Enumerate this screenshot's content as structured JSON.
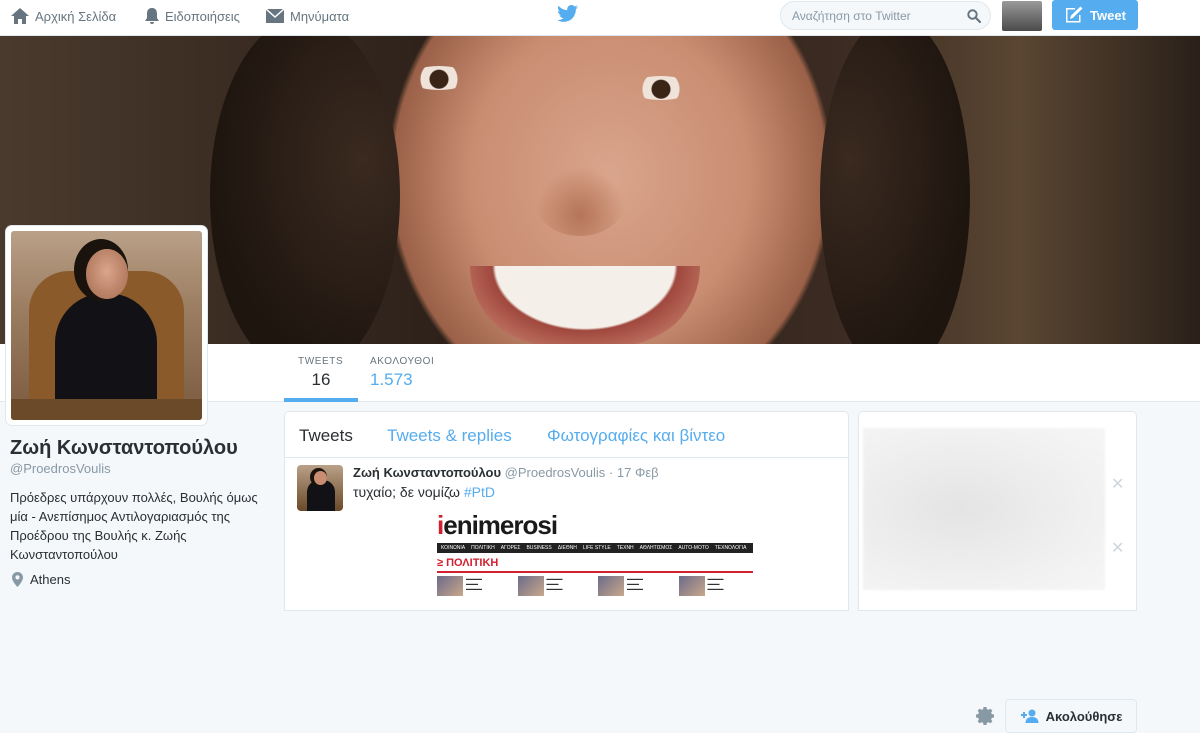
{
  "nav": {
    "home_label": "Αρχική Σελίδα",
    "notifications_label": "Ειδοποιήσεις",
    "messages_label": "Μηνύματα",
    "search_placeholder": "Αναζήτηση στο Twitter",
    "tweet_button_label": "Tweet"
  },
  "profile": {
    "name": "Ζωή Κωνσταντοπούλου",
    "handle": "@ProedrosVoulis",
    "bio": "Πρόεδρες υπάρχουν πολλές, Βουλής όμως μία - Ανεπίσημος Αντιλογαριασμός της Προέδρου της Βουλής κ. Ζωής Κωνσταντοπούλου",
    "location": "Athens"
  },
  "stats": {
    "tweets_label": "TWEETS",
    "tweets_value": "16",
    "following_label": "ΑΚΟΛΟΥΘΟΙ",
    "following_value": "1.573"
  },
  "actions": {
    "follow_label": "Ακολούθησε"
  },
  "timeline": {
    "tabs": [
      {
        "label": "Tweets",
        "active": true
      },
      {
        "label": "Tweets & replies",
        "active": false
      },
      {
        "label": "Φωτογραφίες και βίντεο",
        "active": false
      }
    ],
    "tweet": {
      "fullname": "Ζωή Κωνσταντοπούλου",
      "username": "@ProedrosVoulis",
      "time": "17 Φεβ",
      "text": "τυχαίο; δε νομίζω",
      "hashtag": "#PtD"
    },
    "media": {
      "logo_prefix": "i",
      "logo_rest": "enimerosi",
      "menu": [
        "ΚΟΙΝΩΝΙΑ",
        "ΠΟΛΙΤΙΚΗ",
        "ΑΓΟΡΕΣ",
        "BUSINESS",
        "ΔΙΕΘΝΗ",
        "LIFE STYLE",
        "ΤΕΧΝΗ",
        "ΑΘΛΗΤΙΣΜΟΣ",
        "AUTO-MOTO",
        "ΤΕΧΝΟΛΟΓΙΑ"
      ],
      "section": "≥ ΠΟΛΙΤΙΚΗ"
    }
  },
  "colors": {
    "accent": "#55acee",
    "text": "#292f33",
    "muted": "#8899a6"
  }
}
